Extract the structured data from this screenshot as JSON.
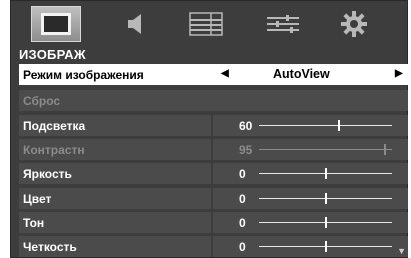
{
  "tabs": [
    {
      "icon": "picture-icon",
      "active": true
    },
    {
      "icon": "speaker-icon",
      "active": false
    },
    {
      "icon": "channel-list-icon",
      "active": false
    },
    {
      "icon": "settings-sliders-icon",
      "active": false
    },
    {
      "icon": "gear-icon",
      "active": false
    }
  ],
  "section_title": "ИЗОБРАЖ",
  "picture_mode": {
    "label": "Режим изображения",
    "value": "AutoView"
  },
  "reset_label": "Сброс",
  "sliders": [
    {
      "label": "Подсветка",
      "value": "60",
      "fraction": 0.6,
      "enabled": true
    },
    {
      "label": "Контрастн",
      "value": "95",
      "fraction": 0.95,
      "enabled": false
    },
    {
      "label": "Яркость",
      "value": "0",
      "fraction": 0.5,
      "enabled": true
    },
    {
      "label": "Цвет",
      "value": "0",
      "fraction": 0.5,
      "enabled": true
    },
    {
      "label": "Тон",
      "value": "0",
      "fraction": 0.5,
      "enabled": true
    },
    {
      "label": "Четкость",
      "value": "0",
      "fraction": 0.5,
      "enabled": true
    }
  ],
  "colors": {
    "background": "#3d3d3d",
    "row": "#4b4b4b",
    "selected_row": "#ffffff",
    "disabled_text": "#8b8b8b"
  }
}
